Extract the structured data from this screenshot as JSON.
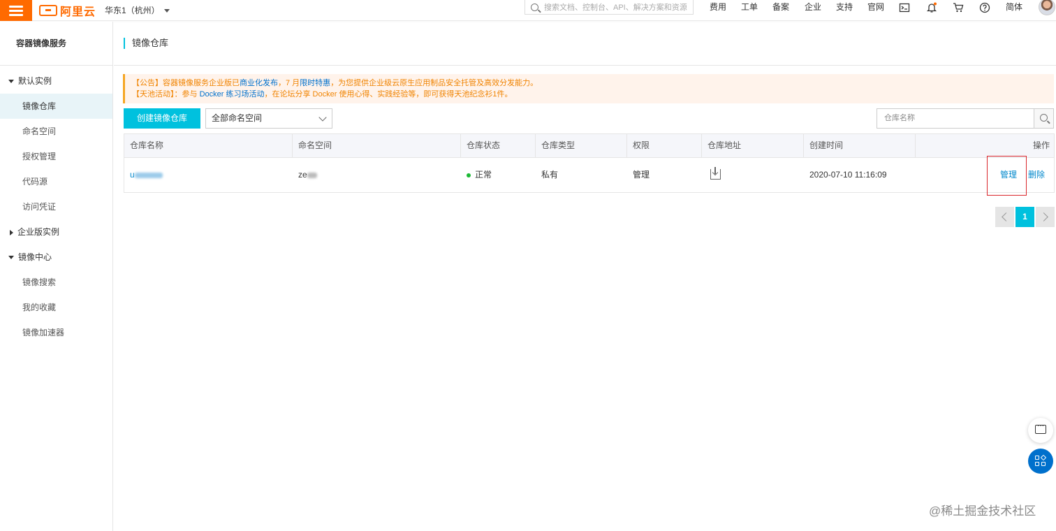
{
  "topbar": {
    "brand": "阿里云",
    "region": "华东1（杭州）",
    "search_placeholder": "搜索文档、控制台、API、解决方案和资源",
    "nav": [
      "费用",
      "工单",
      "备案",
      "企业",
      "支持",
      "官网"
    ],
    "lang": "简体"
  },
  "sidebar": {
    "title": "容器镜像服务",
    "groups": [
      {
        "label": "默认实例",
        "expanded": true,
        "items": [
          "镜像仓库",
          "命名空间",
          "授权管理",
          "代码源",
          "访问凭证"
        ]
      },
      {
        "label": "企业版实例",
        "expanded": false,
        "items": []
      },
      {
        "label": "镜像中心",
        "expanded": true,
        "items": [
          "镜像搜索",
          "我的收藏",
          "镜像加速器"
        ]
      }
    ],
    "active_item": "镜像仓库"
  },
  "main": {
    "breadcrumb": "镜像仓库",
    "notice": {
      "line1_a": "【公告】容器镜像服务企业版已",
      "line1_link1": "商业化发布",
      "line1_b": "，7 月",
      "line1_link2": "限时特惠",
      "line1_c": "，为您提供企业级云原生应用制品安全托管及高效分发能力。",
      "line2_a": "【天池活动】：参与 ",
      "line2_link": "Docker 练习场活动",
      "line2_b": "，在论坛分享 Docker 使用心得、实践经验等，即可获得天池纪念衫1件。"
    },
    "create_button": "创建镜像仓库",
    "namespace_select": "全部命名空间",
    "repo_search_placeholder": "仓库名称",
    "table": {
      "headers": [
        "仓库名称",
        "命名空间",
        "仓库状态",
        "仓库类型",
        "权限",
        "仓库地址",
        "创建时间",
        "操作"
      ],
      "rows": [
        {
          "name": "u",
          "namespace": "ze",
          "status": "正常",
          "type": "私有",
          "permission": "管理",
          "created": "2020-07-10 11:16:09",
          "actions": [
            "管理",
            "删除"
          ]
        }
      ]
    },
    "pagination": {
      "current": "1"
    }
  },
  "watermark": "@稀土掘金技术社区",
  "colors": {
    "accent": "#00c1de",
    "brand": "#ff6a00",
    "link": "#0088cc",
    "highlight": "#d9262b"
  }
}
